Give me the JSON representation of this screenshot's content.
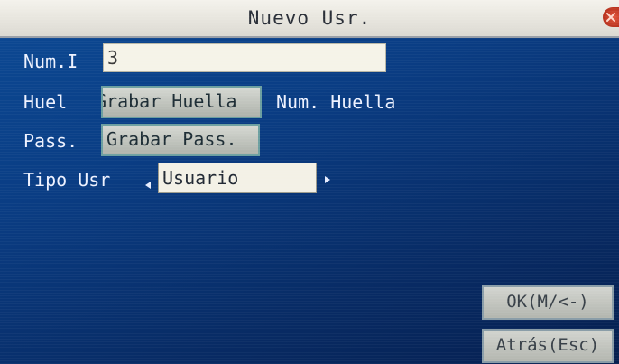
{
  "window": {
    "title": "Nuevo Usr.",
    "close_icon": "close-icon"
  },
  "form": {
    "id": {
      "label": "Num.I",
      "value": "3"
    },
    "fingerprint": {
      "label": "Huel",
      "button_label": "Grabar Huella",
      "count_label": "Num. Huella"
    },
    "password": {
      "label": "Pass.",
      "button_label": "Grabar Pass."
    },
    "user_type": {
      "label": "Tipo Usr",
      "selected": "Usuario",
      "left_arrow_icon": "arrow-left-icon",
      "right_arrow_icon": "arrow-right-icon"
    }
  },
  "actions": {
    "ok_label": "OK(M/<-)",
    "back_label": "Atrás(Esc)"
  },
  "colors": {
    "background": "#0a3d84",
    "title_bar": "#e8e6de",
    "text": "#eef2ff",
    "button": "#c4c7c0",
    "close": "#c9452e"
  }
}
